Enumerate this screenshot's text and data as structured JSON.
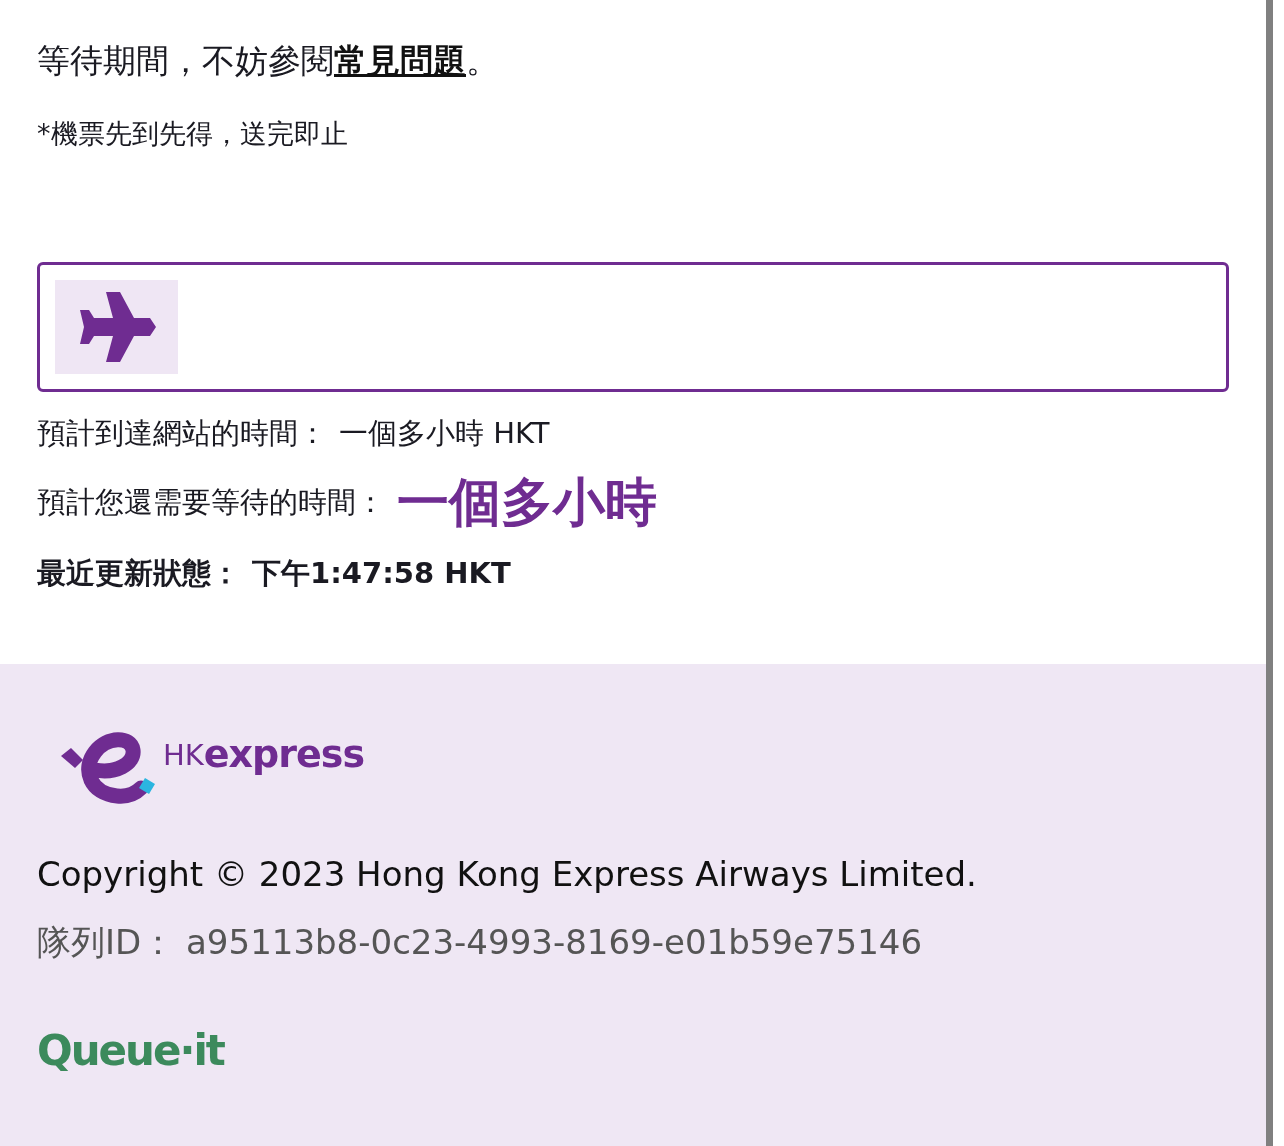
{
  "intro": {
    "text": "等待期間，不妨參閱",
    "link": "常見問題",
    "end": "。"
  },
  "note": "*機票先到先得，送完即止",
  "progress": {
    "level": 0.1
  },
  "arrival": {
    "label": "預計到達網站的時間：",
    "value": "一個多小時 HKT"
  },
  "wait": {
    "label": "預計您還需要等待的時間：",
    "value": "一個多小時"
  },
  "updated": {
    "label": "最近更新狀態：",
    "value": "下午1:47:58 HKT"
  },
  "footer": {
    "brand": {
      "hk": "HK",
      "express": "express"
    },
    "copyright": "Copyright © 2023 Hong Kong Express Airways Limited.",
    "queue_id": {
      "label": "隊列ID：",
      "value": "a95113b8-0c23-4993-8169-e01b59e75146"
    },
    "powered": {
      "main": "Queue",
      "dot": "·",
      "end": "it"
    }
  }
}
